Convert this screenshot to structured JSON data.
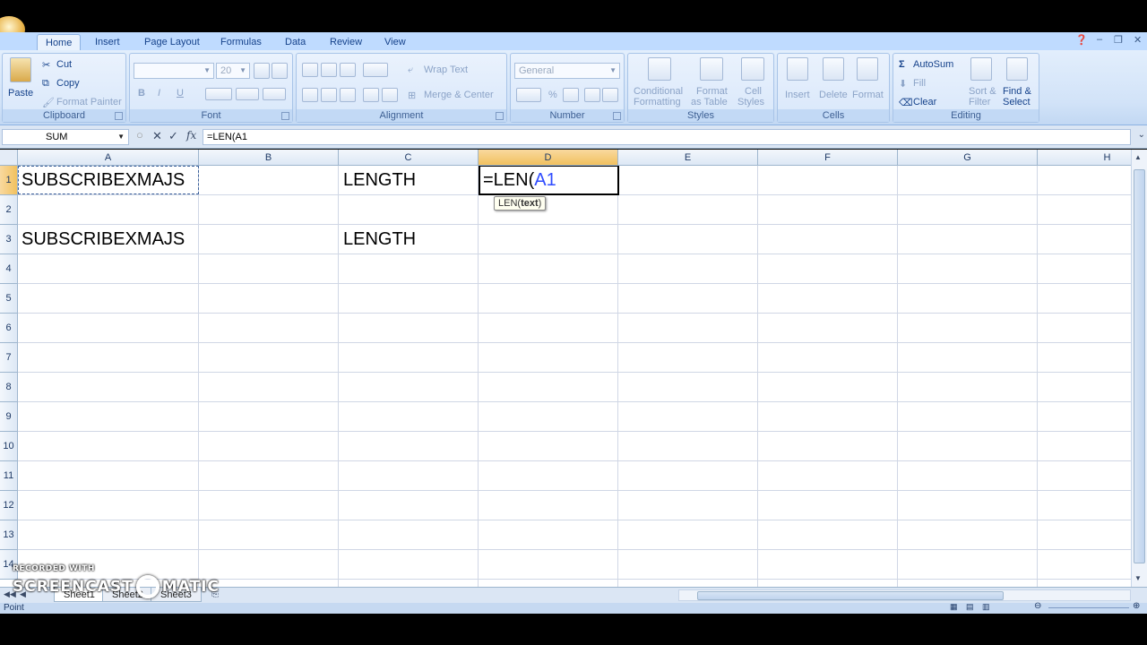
{
  "ribbon_tabs": [
    "Home",
    "Insert",
    "Page Layout",
    "Formulas",
    "Data",
    "Review",
    "View"
  ],
  "clipboard": {
    "label": "Clipboard",
    "paste": "Paste",
    "cut": "Cut",
    "copy": "Copy",
    "format_painter": "Format Painter"
  },
  "font": {
    "label": "Font",
    "name": "",
    "size": "20",
    "bold": "B",
    "italic": "I",
    "underline": "U"
  },
  "alignment": {
    "label": "Alignment",
    "wrap_text": "Wrap Text",
    "merge_center": "Merge & Center"
  },
  "number": {
    "label": "Number",
    "format": "General",
    "percent": "%"
  },
  "styles": {
    "label": "Styles",
    "conditional": "Conditional",
    "conditional2": "Formatting",
    "format_table": "Format",
    "format_table2": "as Table",
    "cell_styles": "Cell",
    "cell_styles2": "Styles"
  },
  "cells": {
    "label": "Cells",
    "insert": "Insert",
    "delete": "Delete",
    "format": "Format"
  },
  "editing": {
    "label": "Editing",
    "autosum": "AutoSum",
    "fill": "Fill",
    "clear": "Clear",
    "sort_filter": "Sort &",
    "sort_filter2": "Filter",
    "find_select": "Find &",
    "find_select2": "Select"
  },
  "formula_bar": {
    "name_box": "SUM",
    "fx": "fx",
    "formula": "=LEN(A1"
  },
  "columns": [
    "A",
    "B",
    "C",
    "D",
    "E",
    "F",
    "G",
    "H"
  ],
  "selected_column": "D",
  "rows": [
    "1",
    "2",
    "3",
    "4",
    "5",
    "6",
    "7",
    "8",
    "9",
    "10",
    "11",
    "12",
    "13",
    "14"
  ],
  "selected_row": "1",
  "cells_data": {
    "a1": "SUBSCRIBEXMAJS",
    "c1": "LENGTH",
    "d1_prefix": "=LEN(",
    "d1_ref": "A1",
    "a3": "SUBSCRIBEXMAJS",
    "c3": "LENGTH"
  },
  "tooltip": {
    "func": "LEN(",
    "arg": "text",
    "close": ")"
  },
  "sheet_tabs": [
    "Sheet1",
    "Sheet2",
    "Sheet3"
  ],
  "status": {
    "mode": "Point"
  },
  "watermark": {
    "line1": "RECORDED WITH",
    "line2a": "SCREENCAST",
    "line2b": "MATIC"
  },
  "colors": {
    "ribbon": "#d2e3f8",
    "selected_header": "#f1c15f",
    "ref_blue": "#2f4cff"
  }
}
